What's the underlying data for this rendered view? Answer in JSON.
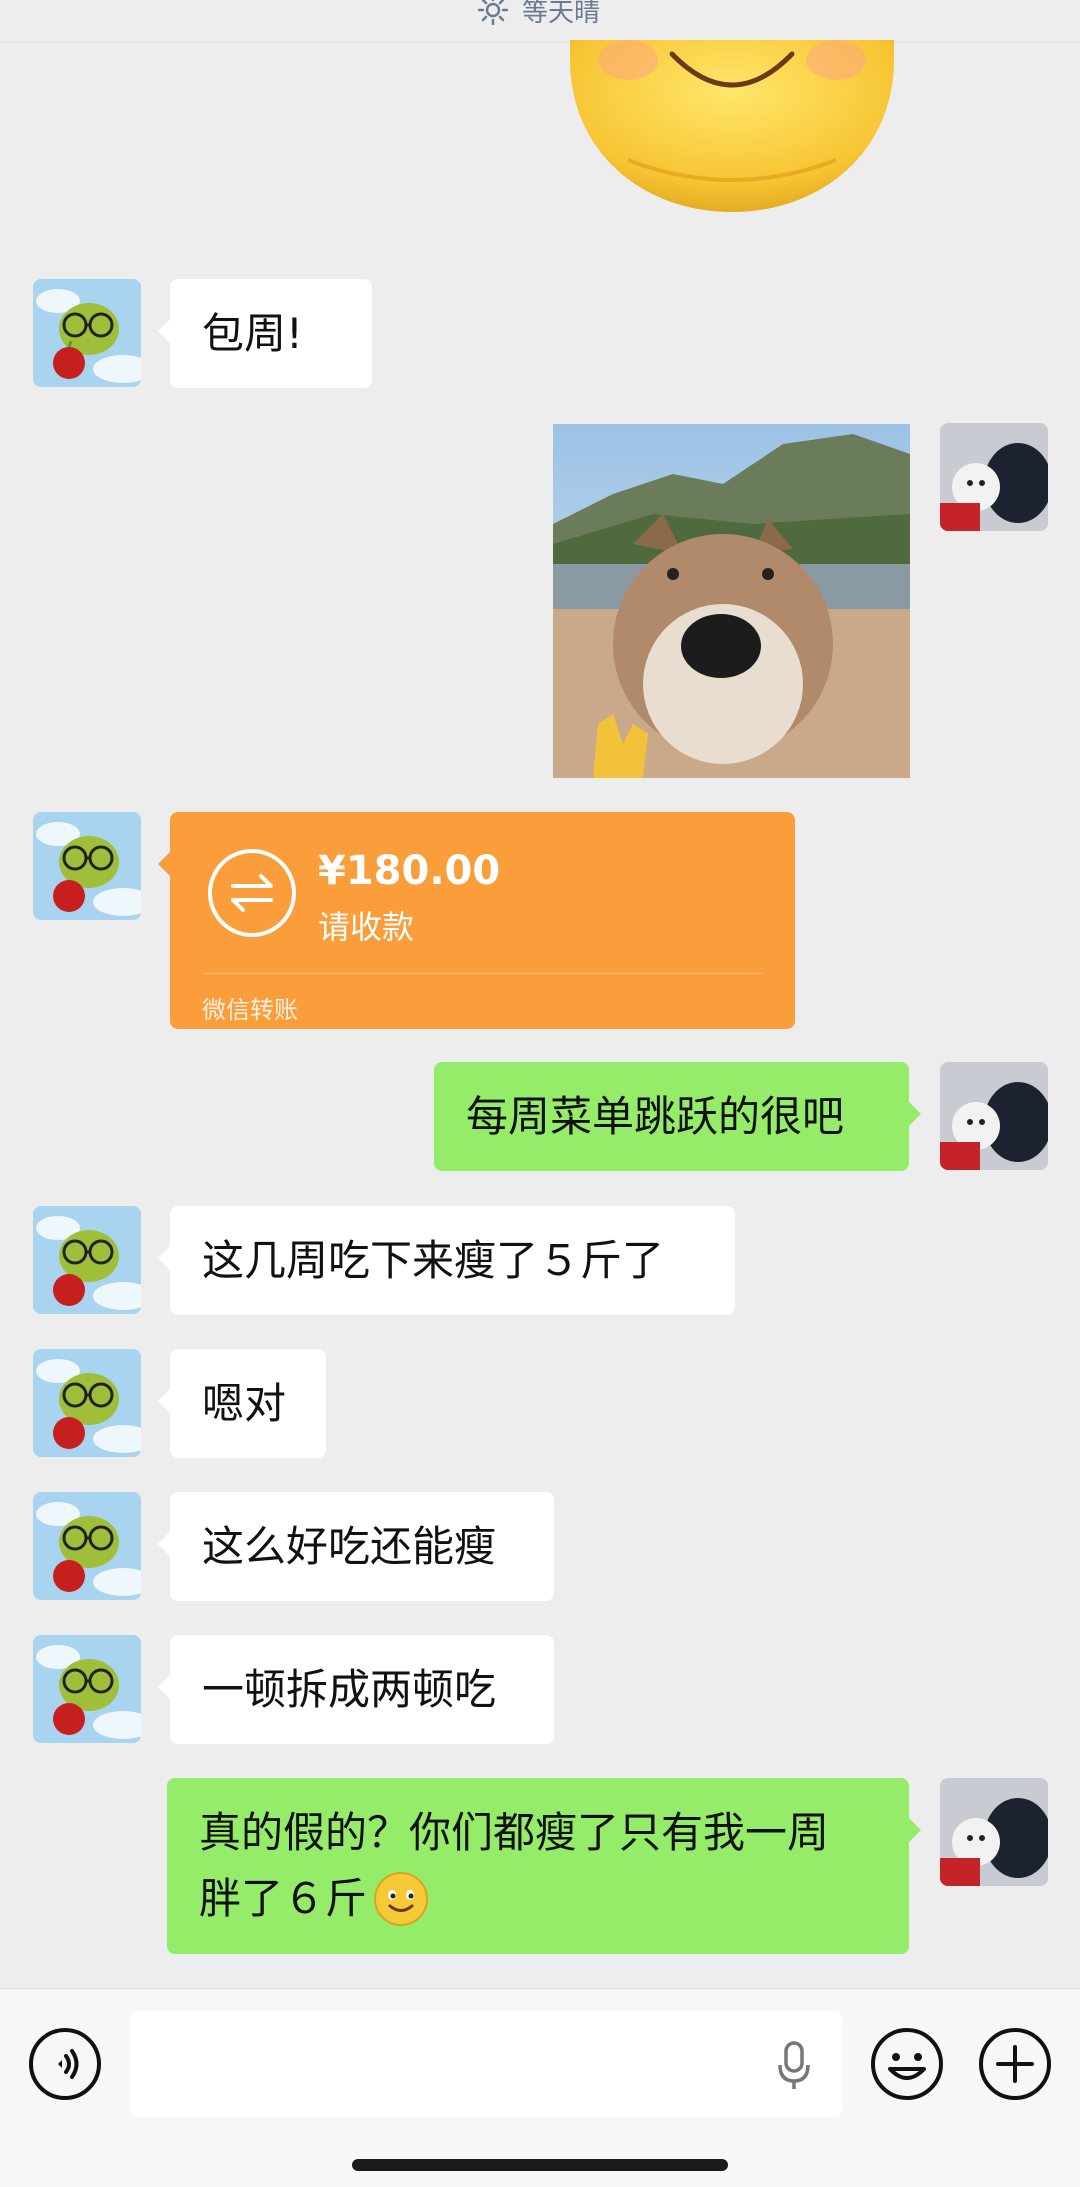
{
  "status": {
    "text": "等天晴"
  },
  "messages": {
    "m1": "包周!",
    "m2_transfer": {
      "amount": "¥180.00",
      "action": "请收款",
      "footer": "微信转账"
    },
    "m3": "每周菜单跳跃的很吧",
    "m4": "这几周吃下来瘦了５斤了",
    "m5": "嗯对",
    "m6": "这么好吃还能瘦",
    "m7": "一顿拆成两顿吃",
    "m8_line1": "真的假的？你们都瘦了只有我一周",
    "m8_line2": "胖了６斤"
  },
  "colors": {
    "background": "#ededed",
    "bubble_left": "#ffffff",
    "bubble_right": "#95ec69",
    "transfer": "#fa9d3b"
  },
  "icons": [
    "sun-icon",
    "smile-emoji-sticker",
    "avatar-frog",
    "avatar-dogs",
    "dog-photo",
    "transfer-icon",
    "voice-icon",
    "mic-icon",
    "emoji-icon",
    "plus-icon",
    "smile-emoji"
  ]
}
